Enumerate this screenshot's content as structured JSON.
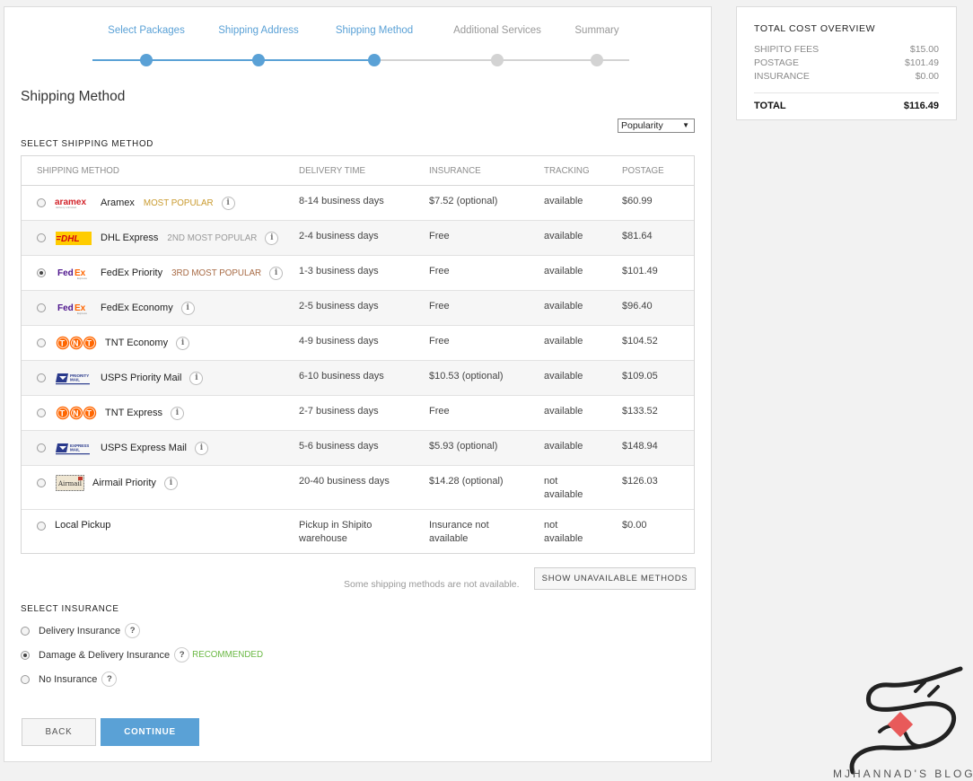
{
  "steps": [
    {
      "label": "Select Packages",
      "state": "done"
    },
    {
      "label": "Shipping Address",
      "state": "done"
    },
    {
      "label": "Shipping Method",
      "state": "current"
    },
    {
      "label": "Additional Services",
      "state": "todo"
    },
    {
      "label": "Summary",
      "state": "todo"
    }
  ],
  "page_title": "Shipping Method",
  "sort": {
    "selected": "Popularity"
  },
  "section_shipping": "SELECT SHIPPING METHOD",
  "table": {
    "headers": {
      "method": "SHIPPING METHOD",
      "time": "DELIVERY TIME",
      "insurance": "INSURANCE",
      "tracking": "TRACKING",
      "postage": "POSTAGE"
    },
    "rows": [
      {
        "carrier": "Aramex",
        "logo": "aramex-logo",
        "badge": "MOST POPULAR",
        "time": "8-14 business days",
        "insurance": "$7.52 (optional)",
        "tracking": "available",
        "postage": "$60.99",
        "selected": false
      },
      {
        "carrier": "DHL Express",
        "logo": "dhl-logo",
        "badge": "2ND MOST POPULAR",
        "time": "2-4 business days",
        "insurance": "Free",
        "tracking": "available",
        "postage": "$81.64",
        "selected": false
      },
      {
        "carrier": "FedEx Priority",
        "logo": "fedex-logo",
        "badge": "3RD MOST POPULAR",
        "time": "1-3 business days",
        "insurance": "Free",
        "tracking": "available",
        "postage": "$101.49",
        "selected": true
      },
      {
        "carrier": "FedEx Economy",
        "logo": "fedex-logo",
        "badge": "",
        "time": "2-5 business days",
        "insurance": "Free",
        "tracking": "available",
        "postage": "$96.40",
        "selected": false
      },
      {
        "carrier": "TNT Economy",
        "logo": "tnt-logo",
        "badge": "",
        "time": "4-9 business days",
        "insurance": "Free",
        "tracking": "available",
        "postage": "$104.52",
        "selected": false
      },
      {
        "carrier": "USPS Priority Mail",
        "logo": "usps-logo",
        "badge": "",
        "time": "6-10 business days",
        "insurance": "$10.53 (optional)",
        "tracking": "available",
        "postage": "$109.05",
        "selected": false
      },
      {
        "carrier": "TNT Express",
        "logo": "tnt-logo",
        "badge": "",
        "time": "2-7 business days",
        "insurance": "Free",
        "tracking": "available",
        "postage": "$133.52",
        "selected": false
      },
      {
        "carrier": "USPS Express Mail",
        "logo": "usps-logo",
        "badge": "",
        "time": "5-6 business days",
        "insurance": "$5.93 (optional)",
        "tracking": "available",
        "postage": "$148.94",
        "selected": false
      },
      {
        "carrier": "Airmail Priority",
        "logo": "airmail-logo",
        "badge": "",
        "time": "20-40 business days",
        "insurance": "$14.28 (optional)",
        "tracking": "not available",
        "postage": "$126.03",
        "selected": false
      },
      {
        "carrier": "Local Pickup",
        "logo": "",
        "badge": "",
        "time": "Pickup in Shipito warehouse",
        "insurance": "Insurance not available",
        "tracking": "not available",
        "postage": "$0.00",
        "selected": false
      }
    ]
  },
  "unavailable_note": "Some shipping methods are not available.",
  "show_unavailable_label": "SHOW UNAVAILABLE METHODS",
  "section_insurance": "SELECT INSURANCE",
  "insurance_options": [
    {
      "label": "Delivery Insurance",
      "selected": false,
      "tag": ""
    },
    {
      "label": "Damage & Delivery Insurance",
      "selected": true,
      "tag": "RECOMMENDED"
    },
    {
      "label": "No Insurance",
      "selected": false,
      "tag": ""
    }
  ],
  "buttons": {
    "back": "BACK",
    "continue": "CONTINUE"
  },
  "cost_overview": {
    "title": "TOTAL COST OVERVIEW",
    "lines": [
      {
        "label": "SHIPITO FEES",
        "value": "$15.00"
      },
      {
        "label": "POSTAGE",
        "value": "$101.49"
      },
      {
        "label": "INSURANCE",
        "value": "$0.00"
      }
    ],
    "total_label": "TOTAL",
    "total_value": "$116.49"
  },
  "watermark_text": "MJHANNAD'S BLOG",
  "colors": {
    "accent": "#5aa1d6",
    "inactive": "#d3d3d3",
    "recommended": "#6ab843"
  }
}
